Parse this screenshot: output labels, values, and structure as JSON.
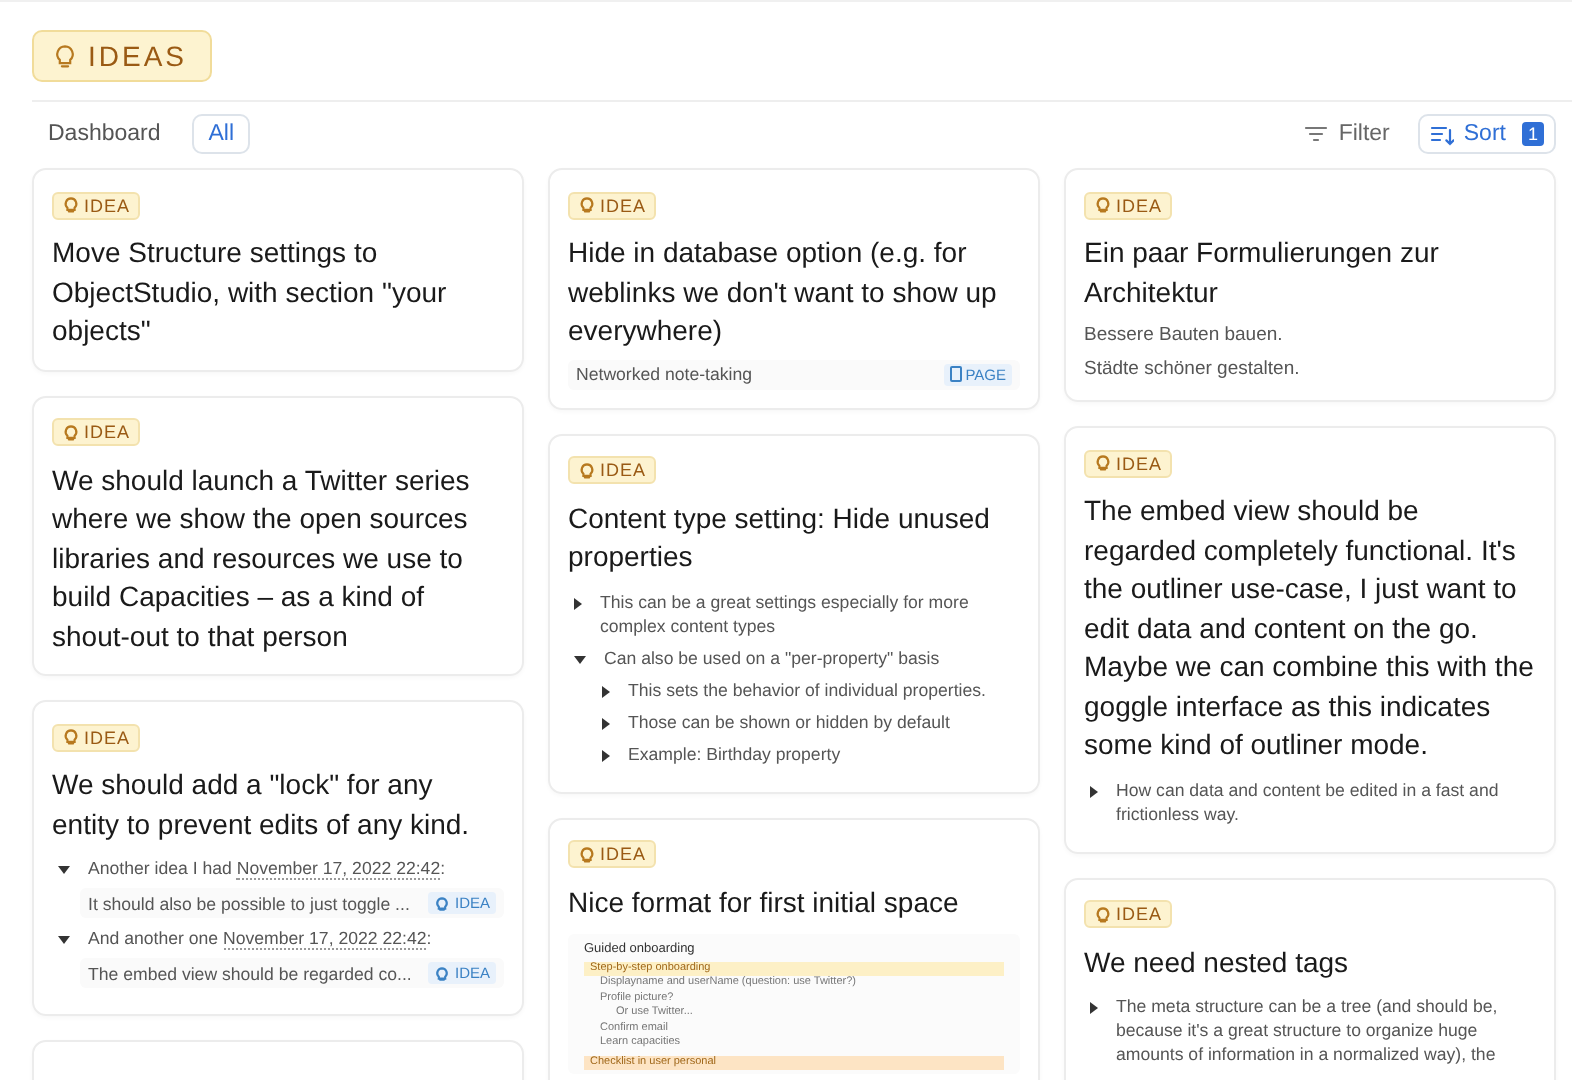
{
  "header": {
    "title": "IDEAS"
  },
  "toolbar": {
    "views": [
      {
        "label": "Dashboard",
        "selected": false
      },
      {
        "label": "All",
        "selected": true
      }
    ],
    "filter": "Filter",
    "sort": {
      "label": "Sort",
      "count": "1"
    }
  },
  "columns": [
    {
      "cards": [
        {
          "tag": "IDEA",
          "title": "Move Structure settings to ObjectStudio, with section \"your objects\""
        },
        {
          "tag": "IDEA",
          "title": "We should launch a Twitter series where we show the open sources libraries and resources we use to build Capacities – as a kind of shout-out to that person"
        },
        {
          "tag": "IDEA",
          "title": "We should add a \"lock\" for any entity to prevent edits of any kind.",
          "body": [
            {
              "kind": "outline",
              "items": [
                {
                  "text": "Another idea I had",
                  "link": "November 17, 2022 22:42",
                  "suffix": ":",
                  "expanded": true,
                  "children": [
                    {
                      "kind": "reference",
                      "text": "It should also be possible to just toggle ...",
                      "badge": {
                        "kind": "idea",
                        "label": "IDEA"
                      }
                    }
                  ]
                },
                {
                  "text": "And another one",
                  "link": "November 17, 2022 22:42",
                  "suffix": ":",
                  "expanded": true,
                  "children": [
                    {
                      "kind": "reference",
                      "text": "The embed view should be regarded co...",
                      "badge": {
                        "kind": "idea",
                        "label": "IDEA"
                      }
                    }
                  ]
                }
              ]
            }
          ]
        },
        {
          "stub": true
        }
      ]
    },
    {
      "cards": [
        {
          "tag": "IDEA",
          "title": "Hide in database option (e.g. for weblinks we don't want to show up everywhere)",
          "body": [
            {
              "kind": "reference",
              "text": "Networked note-taking",
              "badge": {
                "kind": "page",
                "label": "PAGE"
              }
            }
          ]
        },
        {
          "tag": "IDEA",
          "title": "Content type setting: Hide unused properties",
          "body": [
            {
              "kind": "outline",
              "items": [
                {
                  "text": "This can be a great settings especially for more complex content types",
                  "expanded": false
                },
                {
                  "text": "Can also be used on a \"per-property\" basis",
                  "expanded": true,
                  "children": [
                    {
                      "kind": "item",
                      "text": "This sets the behavior of individual properties.",
                      "expanded": false
                    },
                    {
                      "kind": "item",
                      "text": "Those can be shown or hidden by default",
                      "expanded": false
                    },
                    {
                      "kind": "item",
                      "text": "Example: Birthday property",
                      "expanded": false
                    }
                  ]
                }
              ]
            }
          ]
        },
        {
          "tag": "IDEA",
          "title": "Nice format for first initial space",
          "body": [
            {
              "kind": "document",
              "lines": [
                {
                  "text": "Guided onboarding",
                  "kind": "heading"
                },
                {
                  "text": "Step-by-step onboarding",
                  "kind": "highlight"
                },
                {
                  "text": "Displayname and userName (question: use Twitter?)",
                  "kind": "bullet"
                },
                {
                  "text": "Profile picture?",
                  "kind": "bullet"
                },
                {
                  "text": "Or use Twitter...",
                  "kind": "subbullet"
                },
                {
                  "text": "Confirm email",
                  "kind": "bullet"
                },
                {
                  "text": "Learn capacities",
                  "kind": "bullet"
                },
                {
                  "text": "Checklist in user personal",
                  "kind": "highlight2"
                }
              ]
            }
          ]
        }
      ]
    },
    {
      "cards": [
        {
          "tag": "IDEA",
          "title": "Ein paar Formulierungen zur Architektur",
          "body": [
            {
              "kind": "paragraph",
              "text": "Bessere Bauten bauen."
            },
            {
              "kind": "paragraph",
              "text": "Städte schöner gestalten."
            }
          ]
        },
        {
          "tag": "IDEA",
          "title": "The embed view should be regarded completely functional. It's the outliner use-case, I just want to edit data and content on the go. Maybe we can combine this with the goggle interface as this indicates some kind of outliner mode.",
          "body": [
            {
              "kind": "outline",
              "items": [
                {
                  "text": "How can data and content be edited in a fast and frictionless way.",
                  "expanded": false
                }
              ]
            }
          ]
        },
        {
          "tag": "IDEA",
          "title": "We need nested tags",
          "body": [
            {
              "kind": "outline",
              "items": [
                {
                  "text": "The meta structure can be a tree (and should be, because it's a great structure to organize huge amounts of information in a normalized way), the",
                  "expanded": false
                }
              ]
            }
          ]
        }
      ]
    }
  ]
}
